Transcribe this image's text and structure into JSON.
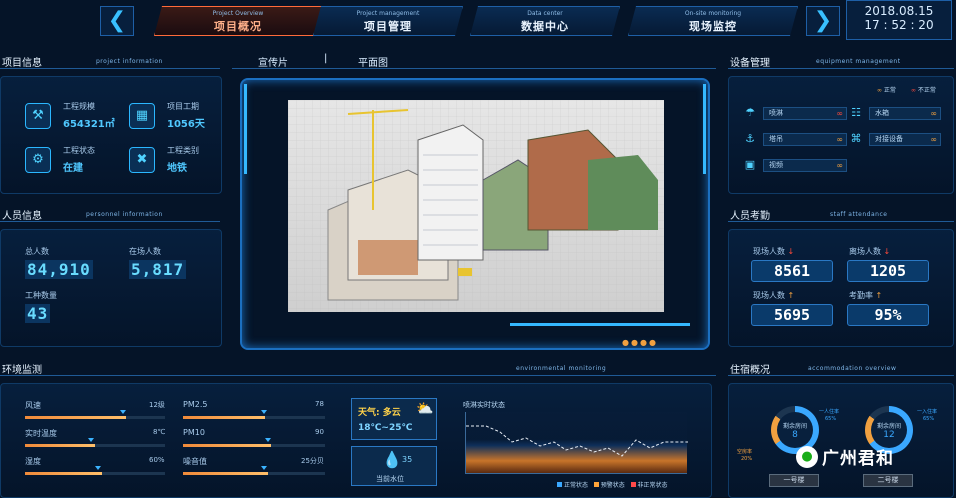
{
  "nav": {
    "prev_icon": "chevron-left",
    "next_icon": "chevron-right",
    "tabs": [
      {
        "en": "Project Overview",
        "zh": "项目概况",
        "active": true
      },
      {
        "en": "Project management",
        "zh": "项目管理",
        "active": false
      },
      {
        "en": "Data center",
        "zh": "数据中心",
        "active": false
      },
      {
        "en": "On-site monitoring",
        "zh": "现场监控",
        "active": false
      }
    ]
  },
  "datetime": {
    "date": "2018.08.15",
    "time": "17 : 52 : 20"
  },
  "project_info": {
    "title": "项目信息",
    "subtitle": "Project information",
    "items": [
      {
        "label": "工程规模",
        "value": "654321㎡",
        "icon": "crane-icon"
      },
      {
        "label": "项目工期",
        "value": "1056天",
        "icon": "calendar-icon"
      },
      {
        "label": "工程状态",
        "value": "在建",
        "icon": "status-icon"
      },
      {
        "label": "工程类别",
        "value": "地铁",
        "icon": "tools-icon"
      }
    ]
  },
  "personnel": {
    "title": "人员信息",
    "subtitle": "Personnel information",
    "total_label": "总人数",
    "total_value": "84,910",
    "onsite_label": "在场人数",
    "onsite_value": "5,817",
    "types_label": "工种数量",
    "types_value": "43"
  },
  "center": {
    "tabs": [
      "宣传片",
      "平面图"
    ],
    "separator": "|"
  },
  "equipment": {
    "title": "设备管理",
    "subtitle": "Equipment management",
    "legend_normal": "正常",
    "legend_abnormal": "不正常",
    "items": [
      {
        "label": "喷淋",
        "icon": "sprinkler-icon",
        "status": "abnormal"
      },
      {
        "label": "水箱",
        "icon": "water-tank-icon",
        "status": "normal"
      },
      {
        "label": "塔吊",
        "icon": "tower-crane-icon",
        "status": "normal"
      },
      {
        "label": "对接设备",
        "icon": "device-icon",
        "status": "normal"
      },
      {
        "label": "视频",
        "icon": "camera-icon",
        "status": "normal"
      }
    ],
    "colors": {
      "normal": "#f0a040",
      "abnormal": "#ff4a3a"
    }
  },
  "attendance": {
    "title": "人员考勤",
    "subtitle": "Staff attendance",
    "items": [
      {
        "label": "现场人数",
        "value": "8561",
        "trend": "down"
      },
      {
        "label": "离场人数",
        "value": "1205",
        "trend": "down"
      },
      {
        "label": "现场人数",
        "value": "5695",
        "trend": "up"
      },
      {
        "label": "考勤率",
        "value": "95%",
        "trend": "up"
      }
    ]
  },
  "env": {
    "title": "环境监测",
    "subtitle": "Environmental monitoring",
    "bars": [
      {
        "label": "风速",
        "value": "12级",
        "fill": 0.72,
        "marker": 0.68
      },
      {
        "label": "PM2.5",
        "value": "78",
        "fill": 0.58,
        "marker": 0.55
      },
      {
        "label": "实时温度",
        "value": "8℃",
        "fill": 0.5,
        "marker": 0.45
      },
      {
        "label": "PM10",
        "value": "90",
        "fill": 0.62,
        "marker": 0.58
      },
      {
        "label": "湿度",
        "value": "60%",
        "fill": 0.55,
        "marker": 0.5
      },
      {
        "label": "噪音值",
        "value": "25分贝",
        "fill": 0.6,
        "marker": 0.55
      }
    ],
    "weather_label": "天气: 多云",
    "weather_range": "18℃~25℃",
    "weather_icon": "cloud-sun-icon",
    "water_value": "35",
    "water_label": "当前水位",
    "water_icon": "drop-icon",
    "spray_title": "喷淋实时状态",
    "spray_legend": [
      "正常状态",
      "预警状态",
      "非正常状态"
    ],
    "spray_colors": [
      "#3aa8ff",
      "#ffa53a",
      "#ff4a4a"
    ]
  },
  "accommodation": {
    "title": "住宿概况",
    "subtitle": "Accommodation overview",
    "rings": [
      {
        "center_label": "剩余房间",
        "center_value": "8",
        "left_label": "空房率",
        "left_value": "20%",
        "right_label": "一人住率",
        "right_value": "65%",
        "button": "一号楼"
      },
      {
        "center_label": "剩余房间",
        "center_value": "12",
        "left_label": "",
        "left_value": "",
        "right_label": "一入住率",
        "right_value": "65%",
        "button": "二号楼"
      }
    ]
  },
  "watermark": "广州君和"
}
